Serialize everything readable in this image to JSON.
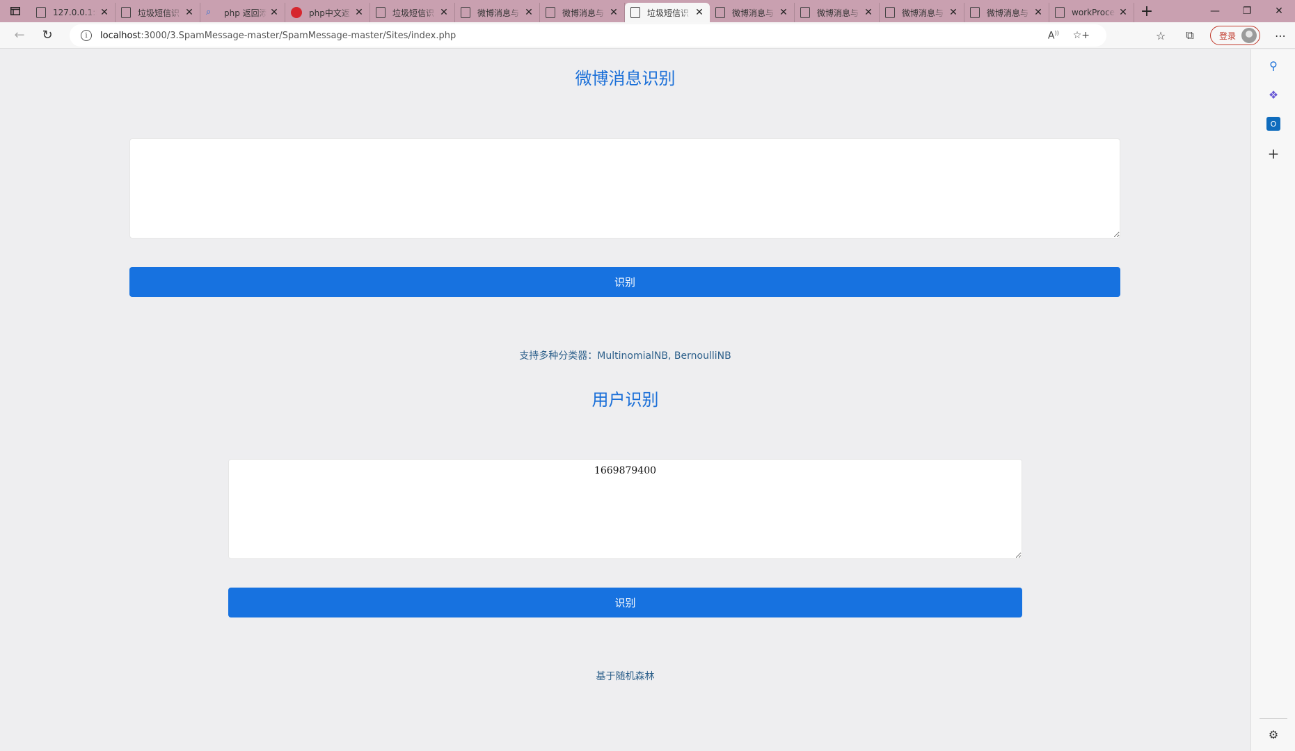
{
  "browser": {
    "tabs": [
      {
        "title": "127.0.0.1:5",
        "icon": "page-icon"
      },
      {
        "title": "垃圾短信识",
        "icon": "page-icon"
      },
      {
        "title": "php 返回添",
        "icon": "search-icon"
      },
      {
        "title": "php中文返",
        "icon": "php-logo-icon"
      },
      {
        "title": "垃圾短信识",
        "icon": "page-icon"
      },
      {
        "title": "微博消息与",
        "icon": "page-icon"
      },
      {
        "title": "微博消息与",
        "icon": "page-icon"
      },
      {
        "title": "垃圾短信识",
        "icon": "page-icon",
        "active": true
      },
      {
        "title": "微博消息与",
        "icon": "page-icon"
      },
      {
        "title": "微博消息与",
        "icon": "page-icon"
      },
      {
        "title": "微博消息与",
        "icon": "page-icon"
      },
      {
        "title": "微博消息与",
        "icon": "page-icon"
      },
      {
        "title": "workProce",
        "icon": "page-icon"
      }
    ],
    "url_host": "localhost",
    "url_path": ":3000/3.SpamMessage-master/SpamMessage-master/Sites/index.php",
    "login_label": "登录"
  },
  "weibo": {
    "title": "微博消息识别",
    "input_value": "",
    "button_label": "识别",
    "note": "支持多种分类器：MultinomialNB, BernoulliNB"
  },
  "user": {
    "title": "用户识别",
    "input_value": "1669879400",
    "button_label": "识别",
    "note": "基于随机森林"
  },
  "colors": {
    "accent": "#1772e0",
    "title": "#1a6fd8",
    "tabbar": "#c9a0b0"
  }
}
